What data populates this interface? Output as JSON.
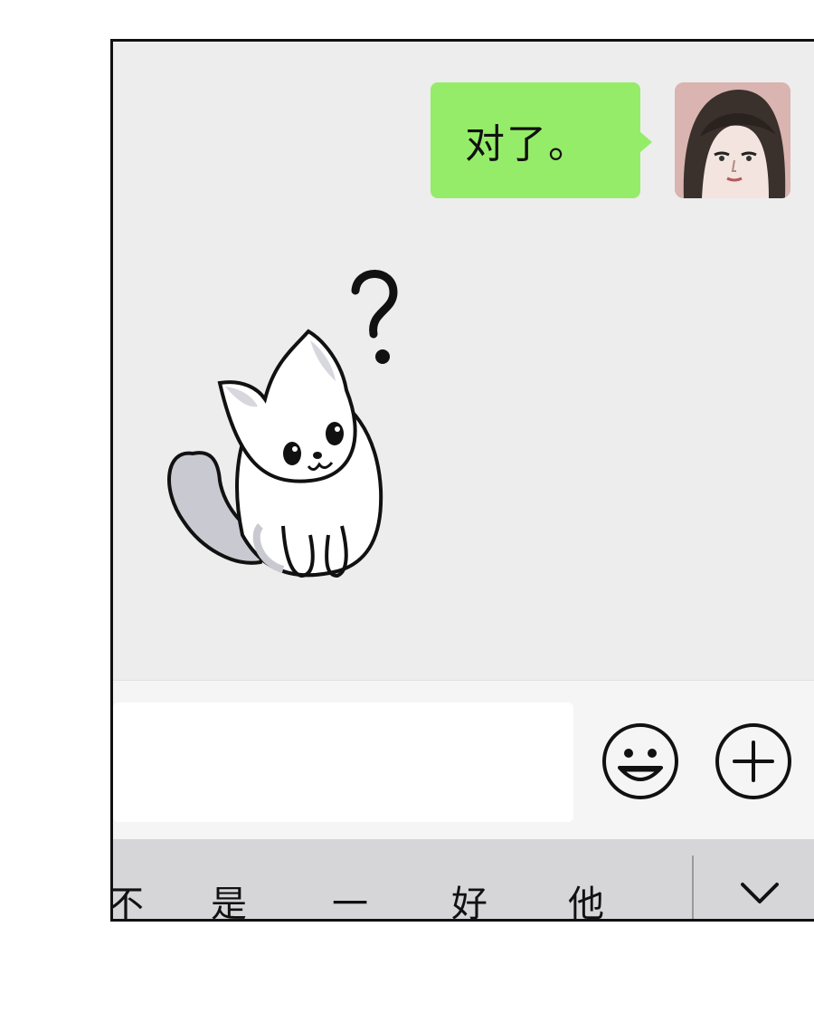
{
  "messages": [
    {
      "side": "right",
      "text": "对了。",
      "avatar": "woman-avatar"
    },
    {
      "side": "left",
      "type": "sticker",
      "sticker": "confused-cat-sticker"
    }
  ],
  "input": {
    "value": "",
    "placeholder": ""
  },
  "icons": {
    "emoji": "smiley-face-icon",
    "more": "plus-circle-icon",
    "collapse": "chevron-down-icon"
  },
  "keyboard": {
    "candidates": [
      "不",
      "是",
      "一",
      "好",
      "他"
    ]
  },
  "colors": {
    "bubble": "#95ec69",
    "chat_bg": "#ededed",
    "input_bar": "#f5f5f5",
    "keyboard_bar": "#d6d6d9"
  }
}
